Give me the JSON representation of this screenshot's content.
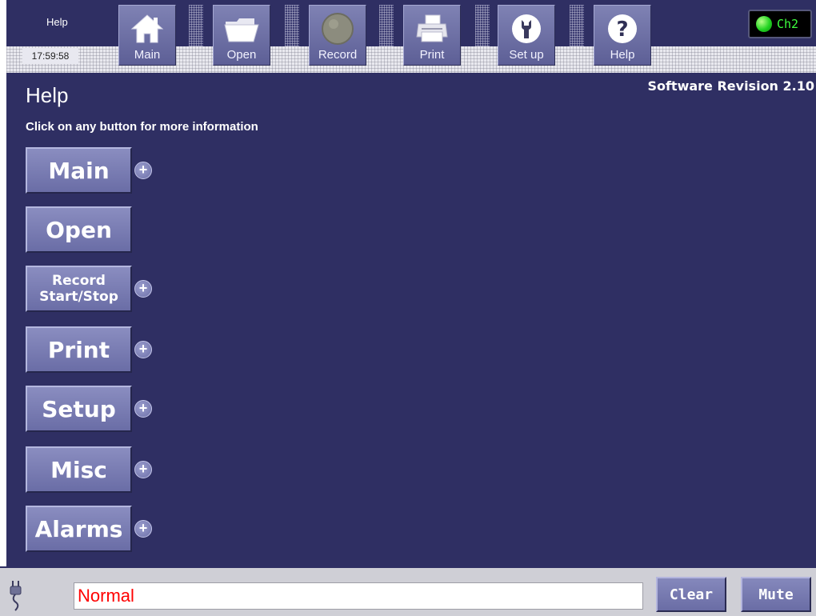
{
  "app": {
    "clock_title": "Help",
    "time": "17:59:58",
    "channel": "Ch2",
    "channel_indicator_color": "#22d422"
  },
  "toolbar": {
    "buttons": [
      {
        "label": "Main",
        "icon": "home-icon"
      },
      {
        "label": "Open",
        "icon": "folder-icon"
      },
      {
        "label": "Record",
        "icon": "record-icon"
      },
      {
        "label": "Print",
        "icon": "printer-icon"
      },
      {
        "label": "Set up",
        "icon": "wrench-icon"
      },
      {
        "label": "Help",
        "icon": "question-icon"
      }
    ]
  },
  "main": {
    "software_revision": "Software Revision 2.10",
    "title": "Help",
    "subtitle": "Click on any button for more information",
    "help_buttons": [
      {
        "label": "Main",
        "has_plus": true
      },
      {
        "label": "Open",
        "has_plus": false
      },
      {
        "label": "Record Start/Stop",
        "line1": "Record",
        "line2": "Start/Stop",
        "has_plus": true
      },
      {
        "label": "Print",
        "has_plus": true
      },
      {
        "label": "Setup",
        "has_plus": true
      },
      {
        "label": "Misc",
        "has_plus": true
      },
      {
        "label": "Alarms",
        "has_plus": true
      }
    ],
    "plus_symbol": "+"
  },
  "statusbar": {
    "status_text": "Normal",
    "status_color": "#ff0000",
    "clear_label": "Clear",
    "mute_label": "Mute",
    "power_icon": "plug-icon"
  },
  "colors": {
    "background": "#2f2f63",
    "button": "#7a7db5"
  }
}
